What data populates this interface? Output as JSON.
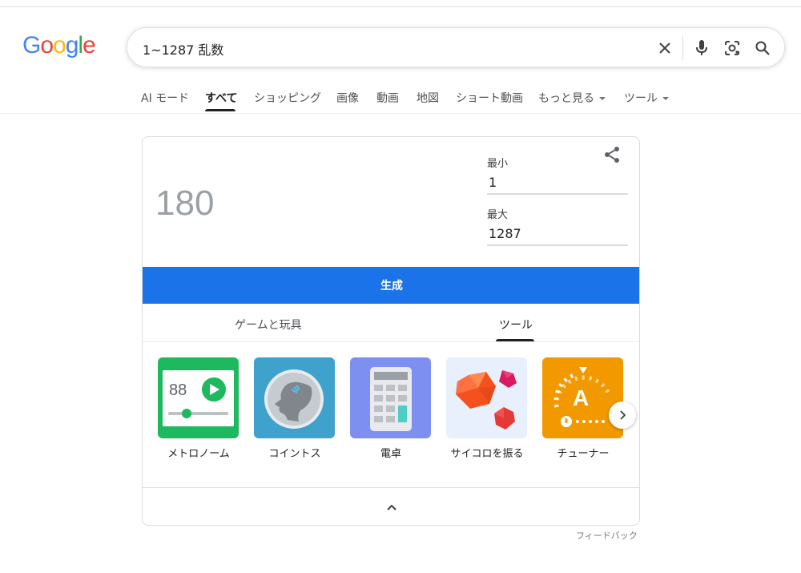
{
  "logo": {
    "letters": [
      "G",
      "o",
      "o",
      "g",
      "l",
      "e"
    ],
    "colors": [
      "#4285F4",
      "#EA4335",
      "#FBBC05",
      "#4285F4",
      "#34A853",
      "#EA4335"
    ]
  },
  "search": {
    "query": "1~1287 乱数",
    "icons": [
      "close-icon",
      "mic-icon",
      "lens-icon",
      "search-icon"
    ]
  },
  "tabs": [
    {
      "label": "AI モード",
      "active": false
    },
    {
      "label": "すべて",
      "active": true
    },
    {
      "label": "ショッピング",
      "active": false
    },
    {
      "label": "画像",
      "active": false
    },
    {
      "label": "動画",
      "active": false
    },
    {
      "label": "地図",
      "active": false
    },
    {
      "label": "ショート動画",
      "active": false
    },
    {
      "label": "もっと見る",
      "active": false,
      "dropdown": true
    },
    {
      "label": "ツール",
      "active": false,
      "dropdown": true
    }
  ],
  "rng": {
    "result": "180",
    "min_label": "最小",
    "min_value": "1",
    "max_label": "最大",
    "max_value": "1287",
    "generate_label": "生成",
    "accent": "#1a73e8"
  },
  "subtabs": [
    {
      "label": "ゲームと玩具",
      "active": false
    },
    {
      "label": "ツール",
      "active": true
    }
  ],
  "tools": [
    {
      "label": "メトロノーム",
      "icon": "metronome-icon",
      "bg": "#1eb85e",
      "display": "88"
    },
    {
      "label": "コイントス",
      "icon": "coin-toss-icon",
      "bg": "#3ea2cc"
    },
    {
      "label": "電卓",
      "icon": "calculator-icon",
      "bg": "#7d8ff1"
    },
    {
      "label": "サイコロを振る",
      "icon": "dice-icon",
      "bg": "#e8f0fe"
    },
    {
      "label": "チューナー",
      "icon": "tuner-icon",
      "bg": "#f29900",
      "display": "A"
    }
  ],
  "feedback": "フィードバック"
}
